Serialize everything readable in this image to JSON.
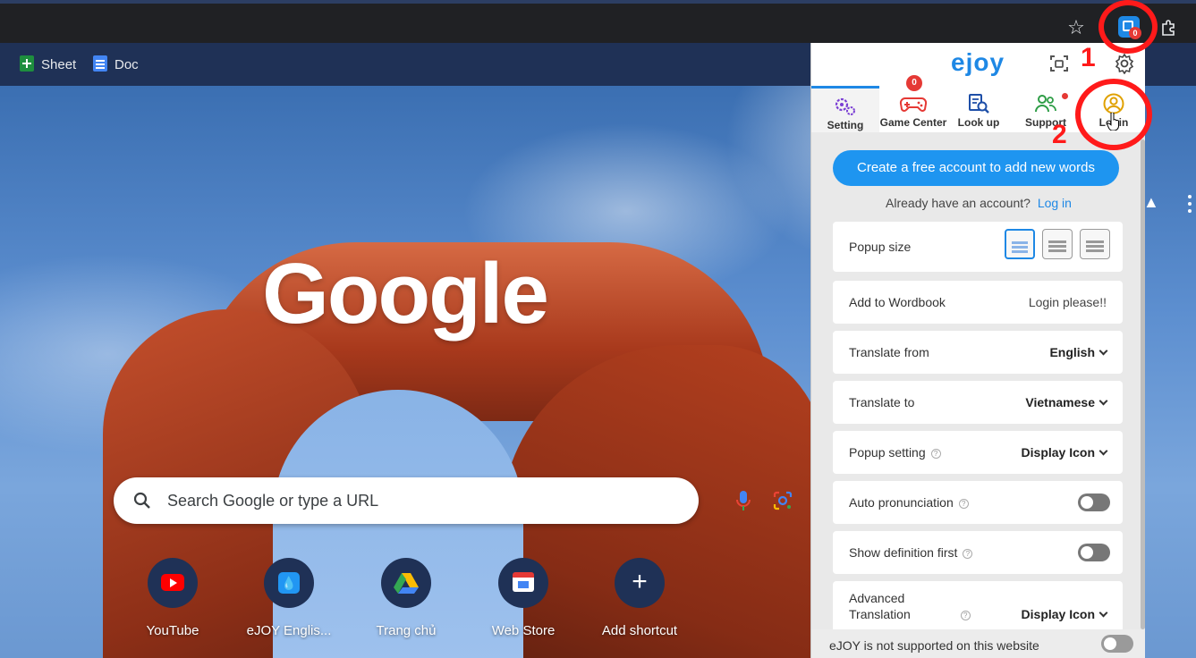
{
  "toolbar": {
    "star_icon": "star-icon",
    "ejoy_badge": "0",
    "extensions_icon": "puzzle-icon"
  },
  "annotations": {
    "step1": "1",
    "step2": "2"
  },
  "bookmarks": [
    {
      "label": "Sheet",
      "icon": "sheets-icon"
    },
    {
      "label": "Doc",
      "icon": "docs-icon"
    }
  ],
  "ntp": {
    "logo": "Google",
    "search_placeholder": "Search Google or type a URL",
    "shortcuts": [
      {
        "label": "YouTube",
        "icon": "youtube-icon"
      },
      {
        "label": "eJOY Englis...",
        "icon": "ejoy-icon"
      },
      {
        "label": "Trang chủ",
        "icon": "drive-icon"
      },
      {
        "label": "Web Store",
        "icon": "webstore-icon"
      },
      {
        "label": "Add shortcut",
        "icon": "plus-icon"
      }
    ]
  },
  "popup": {
    "logo": "ejoy",
    "tabs": [
      {
        "label": "Setting"
      },
      {
        "label": "Game Center",
        "badge": "0"
      },
      {
        "label": "Look up"
      },
      {
        "label": "Support"
      },
      {
        "label": "Login"
      }
    ],
    "cta": "Create a free account to add new words",
    "already_text": "Already have an account?",
    "login_link": "Log in",
    "rows": {
      "popup_size": "Popup size",
      "wordbook_label": "Add to Wordbook",
      "wordbook_value": "Login please!!",
      "from_label": "Translate from",
      "from_value": "English",
      "to_label": "Translate to",
      "to_value": "Vietnamese",
      "popup_setting_label": "Popup setting",
      "popup_setting_value": "Display Icon",
      "auto_pron_label": "Auto pronunciation",
      "show_def_label": "Show definition first",
      "advanced_label_1": "Advanced",
      "advanced_label_2": "Translation",
      "advanced_value": "Display Icon"
    },
    "footer": "eJOY is not supported on this website"
  },
  "colors": {
    "accent": "#1e88e5",
    "annotation": "#ff1a1a"
  }
}
